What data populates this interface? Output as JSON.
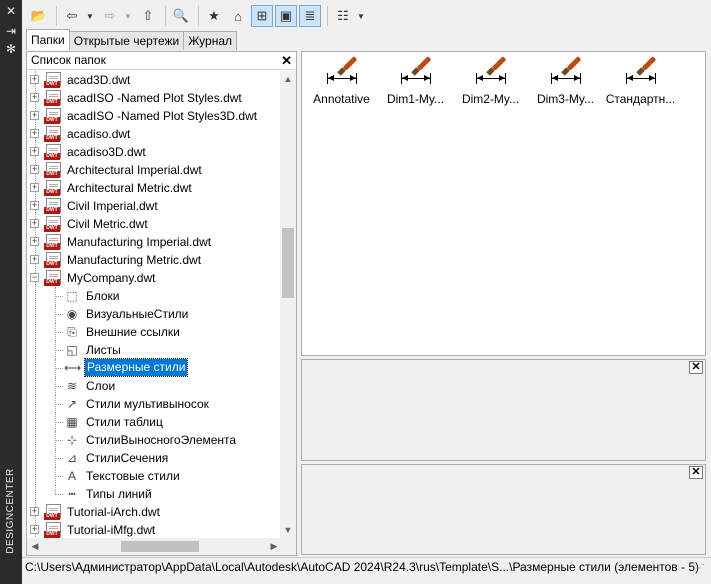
{
  "sidebar": {
    "title": "DESIGNCENTER",
    "btn_close": "✕",
    "btn_pin": "⇥",
    "btn_props": "✻"
  },
  "toolbar": {
    "load": "📂",
    "back": "⇦",
    "back_drop": "▼",
    "forward": "⇨",
    "forward_drop": "▼",
    "up": "⇧",
    "search": "🔍",
    "favorites": "★",
    "home": "⌂",
    "tree_toggle": "⊞",
    "preview": "▣",
    "description": "≣",
    "views": "☷",
    "views_drop": "▼"
  },
  "tabs": [
    {
      "label": "Папки"
    },
    {
      "label": "Открытые чертежи"
    },
    {
      "label": "Журнал"
    }
  ],
  "tree": {
    "header": "Список папок",
    "close": "✕",
    "files": [
      {
        "label": "acad3D.dwt",
        "badge": "DWT",
        "exp": "+"
      },
      {
        "label": "acadISO -Named Plot Styles.dwt",
        "badge": "DWT",
        "exp": "+"
      },
      {
        "label": "acadISO -Named Plot Styles3D.dwt",
        "badge": "DWT",
        "exp": "+"
      },
      {
        "label": "acadiso.dwt",
        "badge": "DWT",
        "exp": "+"
      },
      {
        "label": "acadiso3D.dwt",
        "badge": "DWT",
        "exp": "+"
      },
      {
        "label": "Architectural Imperial.dwt",
        "badge": "DWT",
        "exp": "+"
      },
      {
        "label": "Architectural Metric.dwt",
        "badge": "DWT",
        "exp": "+"
      },
      {
        "label": "Civil Imperial.dwt",
        "badge": "DWT",
        "exp": "+"
      },
      {
        "label": "Civil Metric.dwt",
        "badge": "DWT",
        "exp": "+"
      },
      {
        "label": "Manufacturing Imperial.dwt",
        "badge": "DWT",
        "exp": "+"
      },
      {
        "label": "Manufacturing Metric.dwt",
        "badge": "DWT",
        "exp": "+"
      },
      {
        "label": "MyCompany.dwt",
        "badge": "DWT",
        "exp": "−"
      }
    ],
    "children": [
      {
        "label": "Блоки",
        "icon": "⬚",
        "icon_name": "blocks-icon"
      },
      {
        "label": "ВизуальныеСтили",
        "icon": "◉",
        "icon_name": "visual-styles-icon"
      },
      {
        "label": "Внешние ссылки",
        "icon": "⎘",
        "icon_name": "xrefs-icon"
      },
      {
        "label": "Листы",
        "icon": "◱",
        "icon_name": "layouts-icon"
      },
      {
        "label": "Размерные стили",
        "icon": "⟷",
        "icon_name": "dimstyles-icon",
        "selected": true
      },
      {
        "label": "Слои",
        "icon": "≋",
        "icon_name": "layers-icon"
      },
      {
        "label": "Стили мультивыносок",
        "icon": "↗",
        "icon_name": "mleader-styles-icon"
      },
      {
        "label": "Стили таблиц",
        "icon": "▦",
        "icon_name": "table-styles-icon"
      },
      {
        "label": "СтилиВыносногоЭлемента",
        "icon": "⊹",
        "icon_name": "detail-view-styles-icon"
      },
      {
        "label": "СтилиСечения",
        "icon": "⊿",
        "icon_name": "section-view-styles-icon"
      },
      {
        "label": "Текстовые стили",
        "icon": "A",
        "icon_name": "text-styles-icon"
      },
      {
        "label": "Типы линий",
        "icon": "┅",
        "icon_name": "linetypes-icon"
      }
    ],
    "tail": [
      {
        "label": "Tutorial-iArch.dwt",
        "badge": "DWT",
        "exp": "+"
      },
      {
        "label": "Tutorial-iMfg.dwt",
        "badge": "DWT",
        "exp": "+"
      }
    ],
    "scroll_up": "▲",
    "scroll_down": "▼",
    "scroll_left": "◀",
    "scroll_right": "▶"
  },
  "content": {
    "items": [
      {
        "label": "Annotative"
      },
      {
        "label": "Dim1-My..."
      },
      {
        "label": "Dim2-My..."
      },
      {
        "label": "Dim3-My..."
      },
      {
        "label": "Стандартн..."
      }
    ]
  },
  "preview": {
    "close": "✕"
  },
  "description": {
    "close": "✕"
  },
  "status": {
    "path": "C:\\Users\\Администратор\\AppData\\Local\\Autodesk\\AutoCAD 2024\\R24.3\\rus\\Template\\S...\\Размерные стили (элементов - 5)",
    "grip": "⋰"
  }
}
